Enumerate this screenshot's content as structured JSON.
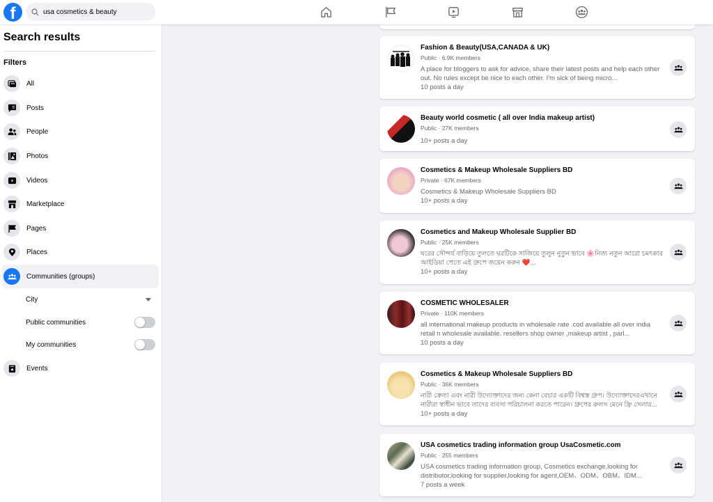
{
  "header": {
    "logo": "f",
    "search_value": "usa cosmetics & beauty",
    "nav": [
      {
        "name": "home-icon"
      },
      {
        "name": "pages-flag-icon"
      },
      {
        "name": "watch-video-icon"
      },
      {
        "name": "marketplace-icon"
      },
      {
        "name": "groups-icon"
      }
    ]
  },
  "sidebar": {
    "title": "Search results",
    "filters_label": "Filters",
    "items": [
      {
        "label": "All",
        "icon": "all-icon"
      },
      {
        "label": "Posts",
        "icon": "posts-icon"
      },
      {
        "label": "People",
        "icon": "people-icon"
      },
      {
        "label": "Photos",
        "icon": "photos-icon"
      },
      {
        "label": "Videos",
        "icon": "videos-icon"
      },
      {
        "label": "Marketplace",
        "icon": "marketplace-icon"
      },
      {
        "label": "Pages",
        "icon": "pages-flag-icon"
      },
      {
        "label": "Places",
        "icon": "location-pin-icon"
      },
      {
        "label": "Communities (groups)",
        "icon": "groups-icon",
        "active": true
      },
      {
        "label": "Events",
        "icon": "events-icon"
      }
    ],
    "sub_filters": {
      "city": "City",
      "public": "Public communities",
      "public_on": false,
      "mine": "My communities",
      "mine_on": false
    }
  },
  "results": [
    {
      "title": "Fashion & Beauty(USA,CANADA & UK)",
      "meta": "Public · 6.9K members",
      "desc": "A place for bloggers to ask for advice, share their latest posts and help each other out. No rules except be nice to each other. I'm sick of being micro...",
      "freq": "10 posts a day"
    },
    {
      "title": "Beauty world cosmetic ( all over India makeup artist)",
      "meta": "Public · 27K members",
      "desc": "",
      "freq": "10+ posts a day"
    },
    {
      "title": "Cosmetics & Makeup Wholesale Suppliers BD",
      "meta": "Private · 67K members",
      "desc": "Cosmetics & Makeup Wholesale Suppliers BD",
      "freq": "10+ posts a day"
    },
    {
      "title": "Cosmetics and Makeup Wholesale Supplier BD",
      "meta": "Public · 25K members",
      "desc": "ঘরের সৌন্দর্য বাড়িয়ে তুলতে ঘরটিকে সাজিয়ে তুলুন নুতুন ভাবে 🌸নিত্য নতুন আরো চমৎকার আইডিয়া পেতে এই গ্রুপে জয়েন করুন ❤️...",
      "freq": "10+ posts a day"
    },
    {
      "title": "COSMETIC WHOLESALER",
      "meta": "Private · 110K members",
      "desc": "all international makeup products in wholesale rate .cod available all over india retail n wholesale available. resellers shop owner ,makeup artist , parl...",
      "freq": "10 posts a day"
    },
    {
      "title": "Cosmetics & Makeup Wholesale Suppliers BD",
      "meta": "Public · 36K members",
      "desc": "নারী ক্রেতা এবং নারী উদ্যোক্তাদের জন্য কেনা বেচার একটি বিশ্বস্ত গ্রুপ। উদ্যোক্তাদেরএখানে নারীরা স্বাধীন ভাবে তাদের ব্যবসা পরিচালনা করতে পারেন। গ্রুপের রুলস মেনে ফ্রি সেলার...",
      "freq": "10+ posts a day"
    },
    {
      "title": "USA cosmetics trading information group UsaCosmetic.com",
      "meta": "Public · 255 members",
      "desc": "USA cosmetics trading information group, Cosmetics exchange,looking for distributor,looking for supplier,looking for agent,OEM、ODM、OBM、IDM...",
      "freq": "7 posts a week"
    }
  ],
  "colors": {
    "brand": "#1877f2",
    "background": "#f0f2f5",
    "secondary_text": "#65676b"
  }
}
